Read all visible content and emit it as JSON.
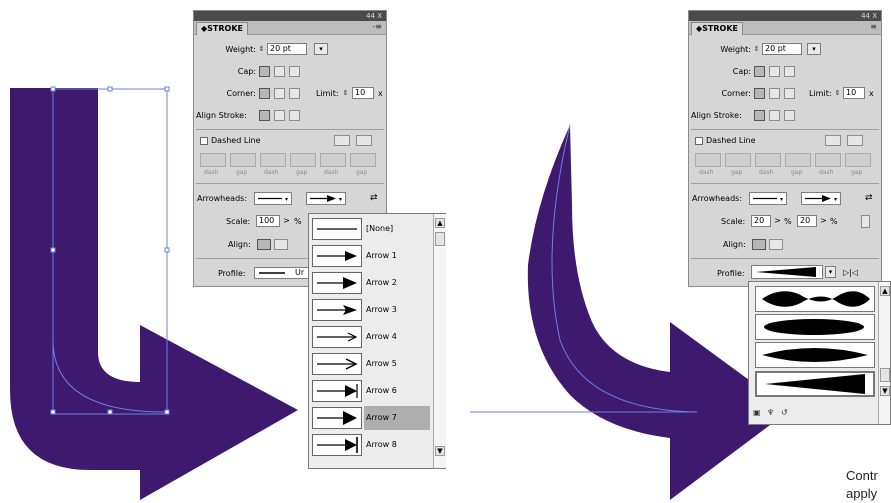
{
  "colors": {
    "shape": "#3d1a6e",
    "path": "#6f7fe6"
  },
  "panel_left": {
    "tab_title": "STROKE",
    "title_controls": "44 X",
    "menu_icon": "-≡",
    "weight_label": "Weight:",
    "weight_value": "20 pt",
    "cap_label": "Cap:",
    "corner_label": "Corner:",
    "limit_label": "Limit:",
    "limit_value": "10",
    "limit_unit": "x",
    "align_stroke_label": "Align Stroke:",
    "dashed_label": "Dashed Line",
    "dash_labels": [
      "dash",
      "gap",
      "dash",
      "gap",
      "dash",
      "gap"
    ],
    "arrowheads_label": "Arrowheads:",
    "scale_label": "Scale:",
    "scale_value": "100",
    "scale_unit": "%",
    "align_label": "Align:",
    "profile_label": "Profile:",
    "profile_value": "Ur"
  },
  "arrow_list": {
    "items": [
      "[None]",
      "Arrow 1",
      "Arrow 2",
      "Arrow 3",
      "Arrow 4",
      "Arrow 5",
      "Arrow 6",
      "Arrow 7",
      "Arrow 8"
    ],
    "selected": "Arrow 7"
  },
  "panel_right": {
    "tab_title": "STROKE",
    "title_controls": "44 X",
    "menu_icon": "≡",
    "weight_label": "Weight:",
    "weight_value": "20 pt",
    "cap_label": "Cap:",
    "corner_label": "Corner:",
    "limit_label": "Limit:",
    "limit_value": "10",
    "limit_unit": "x",
    "align_stroke_label": "Align Stroke:",
    "dashed_label": "Dashed Line",
    "dash_labels": [
      "dash",
      "gap",
      "dash",
      "gap",
      "dash",
      "gap"
    ],
    "arrowheads_label": "Arrowheads:",
    "scale_label": "Scale:",
    "scale_start": "20",
    "scale_end": "20",
    "scale_unit": "%",
    "align_label": "Align:",
    "profile_label": "Profile:"
  },
  "caption": {
    "line1": "Contr",
    "line2": "apply"
  }
}
